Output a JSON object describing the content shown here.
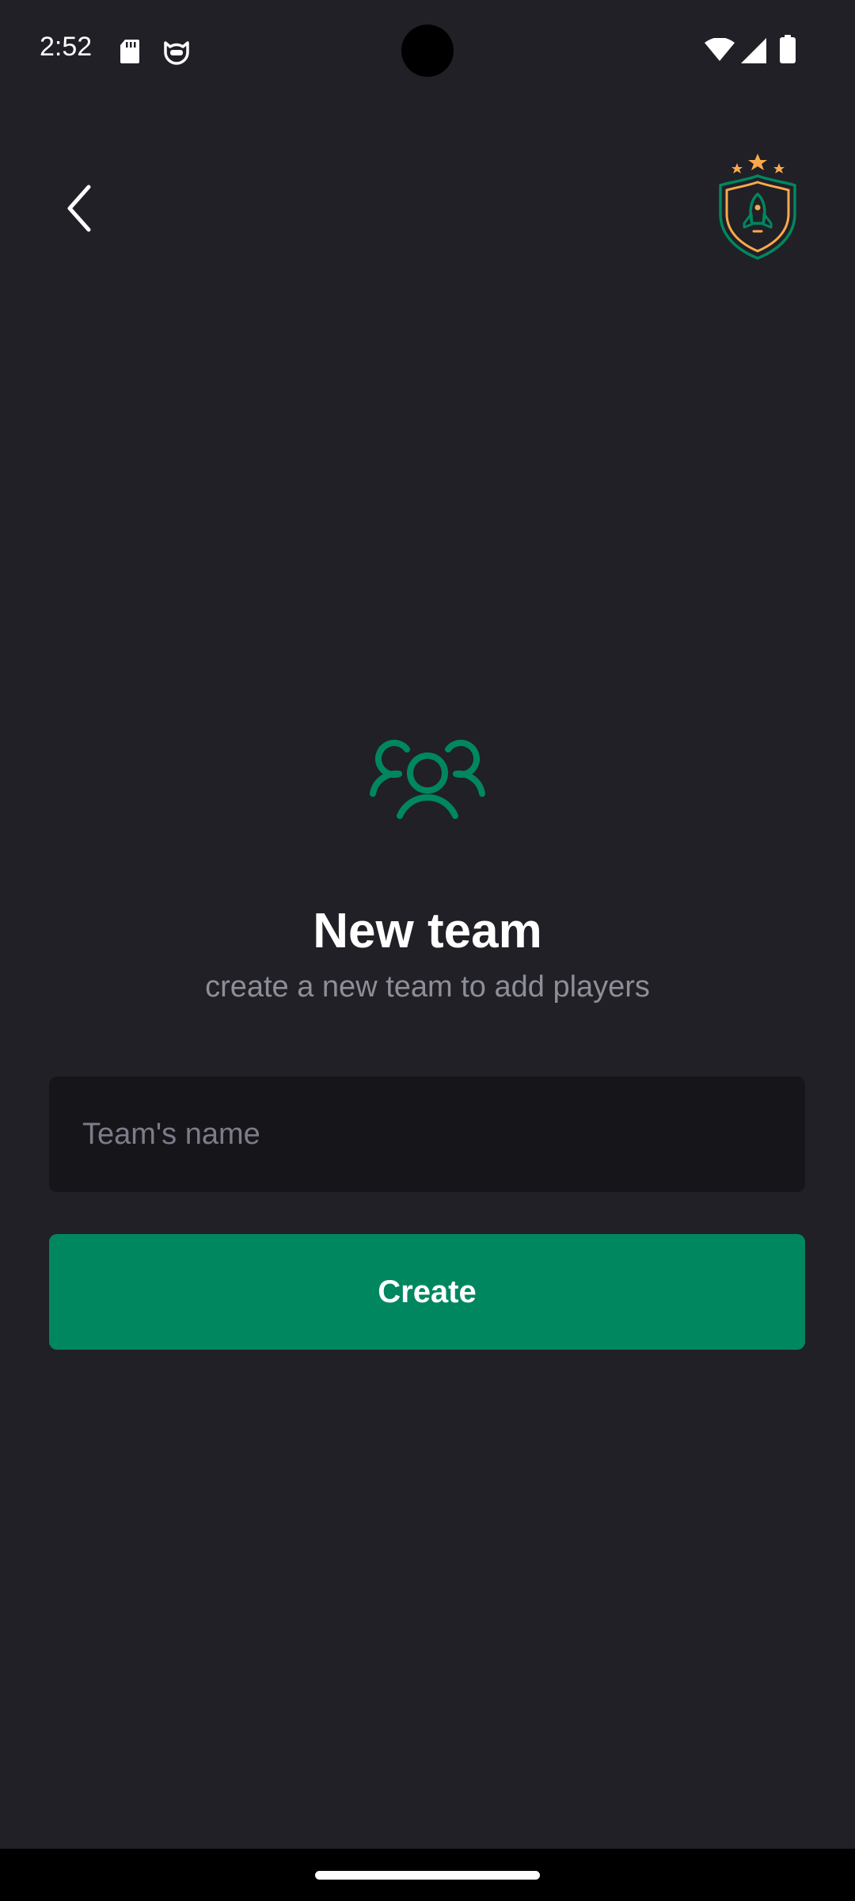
{
  "status_bar": {
    "time": "2:52",
    "icons": [
      "sd-card-icon",
      "cat-icon",
      "wifi-icon",
      "signal-icon",
      "battery-icon"
    ]
  },
  "header": {
    "back_icon": "chevron-left-icon",
    "logo": "shield-rocket-logo"
  },
  "main": {
    "icon": "users-group-icon",
    "title": "New team",
    "subtitle": "create a new team to add players",
    "input": {
      "value": "",
      "placeholder": "Team's name"
    },
    "create_button_label": "Create"
  },
  "colors": {
    "background": "#202026",
    "input_background": "#16161a",
    "accent_green": "#00875f",
    "logo_orange": "#fba94c",
    "subtitle_gray": "#8e8e99",
    "placeholder_gray": "#7c7c8a"
  }
}
